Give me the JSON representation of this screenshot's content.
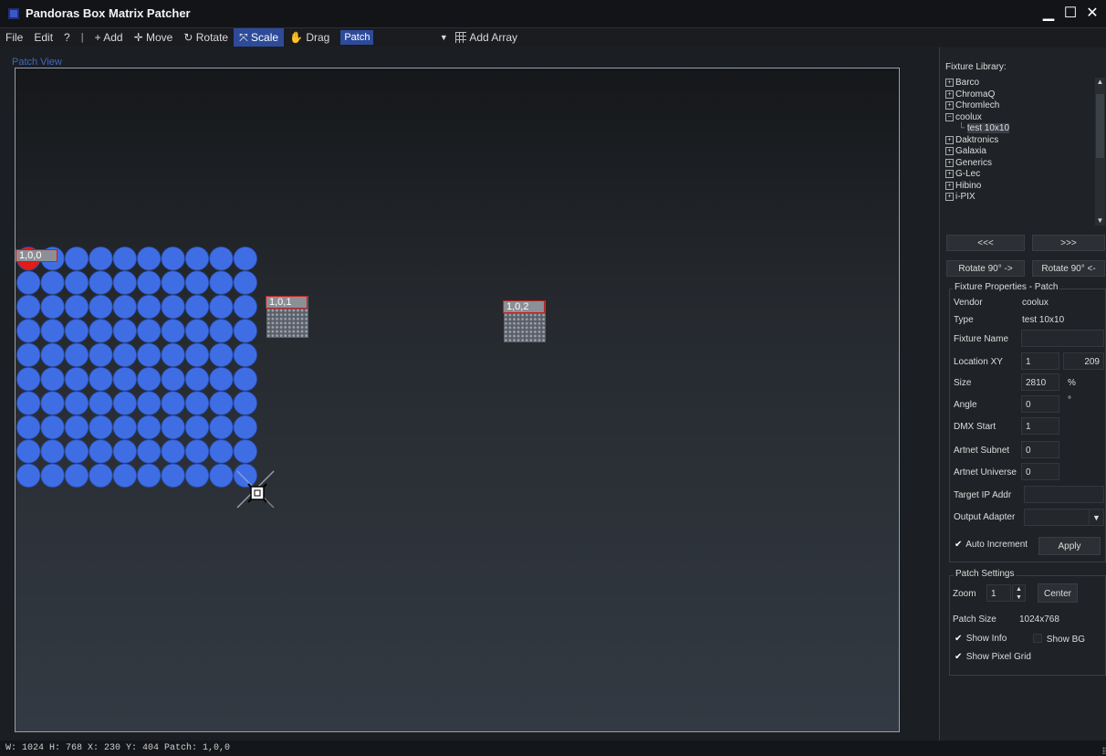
{
  "window": {
    "title": "Pandoras Box Matrix Patcher",
    "controls": {
      "minimize": "▁",
      "maximize": "☐",
      "close": "✕"
    }
  },
  "toolbar": {
    "file": "File",
    "edit": "Edit",
    "help": "?",
    "separator": "|",
    "add": "+ Add",
    "move": "✛ Move",
    "rotate": "↻ Rotate",
    "scale": "⤧ Scale",
    "drag": "✋ Drag",
    "mode_value": "Patch",
    "mode_arrow": "▼",
    "add_array": "Add Array"
  },
  "patch_view": {
    "label": "Patch View",
    "fixtures": [
      {
        "tag": "1,0,0",
        "selected": true
      },
      {
        "tag": "1,0,1"
      },
      {
        "tag": "1,0,2"
      }
    ],
    "grid_rows": 10,
    "grid_cols": 10,
    "fixture_color": "#3f6ee4",
    "selected_pixel_color": "#e21b1b"
  },
  "library": {
    "label": "Fixture Library:",
    "items": [
      {
        "label": "Barco",
        "expanded": false
      },
      {
        "label": "ChromaQ",
        "expanded": false
      },
      {
        "label": "Chromlech",
        "expanded": false
      },
      {
        "label": "coolux",
        "expanded": true
      },
      {
        "label": "test 10x10",
        "child": true
      },
      {
        "label": "Daktronics",
        "expanded": false
      },
      {
        "label": "Galaxia",
        "expanded": false
      },
      {
        "label": "Generics",
        "expanded": false
      },
      {
        "label": "G-Lec",
        "expanded": false
      },
      {
        "label": "Hibino",
        "expanded": false
      },
      {
        "label": "i-PIX",
        "expanded": false
      }
    ],
    "prev": "<<<",
    "next": ">>>",
    "rotate_cw": "Rotate 90° ->",
    "rotate_ccw": "Rotate 90° <-"
  },
  "properties": {
    "title": "Fixture Properties - Patch",
    "vendor_label": "Vendor",
    "vendor": "coolux",
    "type_label": "Type",
    "type": "test 10x10",
    "name_label": "Fixture Name",
    "name": "",
    "location_label": "Location XY",
    "location_x": "1",
    "location_y": "209",
    "size_label": "Size",
    "size": "2810",
    "size_unit": "%",
    "angle_label": "Angle",
    "angle": "0",
    "angle_unit": "°",
    "dmx_label": "DMX Start",
    "dmx": "1",
    "subnet_label": "Artnet Subnet",
    "subnet": "0",
    "universe_label": "Artnet Universe",
    "universe": "0",
    "ip_label": "Target IP Addr",
    "ip": "",
    "adapter_label": "Output Adapter",
    "adapter": "",
    "adapter_arrow": "▼",
    "auto_increment": "Auto Increment",
    "apply": "Apply"
  },
  "settings": {
    "title": "Patch Settings",
    "zoom_label": "Zoom",
    "zoom": "1",
    "center": "Center",
    "patch_size_label": "Patch Size",
    "patch_size": "1024x768",
    "show_info": "Show Info",
    "show_bg": "Show BG",
    "show_pixel_grid": "Show Pixel Grid"
  },
  "status": {
    "text": "W: 1024  H: 768  X: 230  Y: 404  Patch: 1,0,0"
  }
}
